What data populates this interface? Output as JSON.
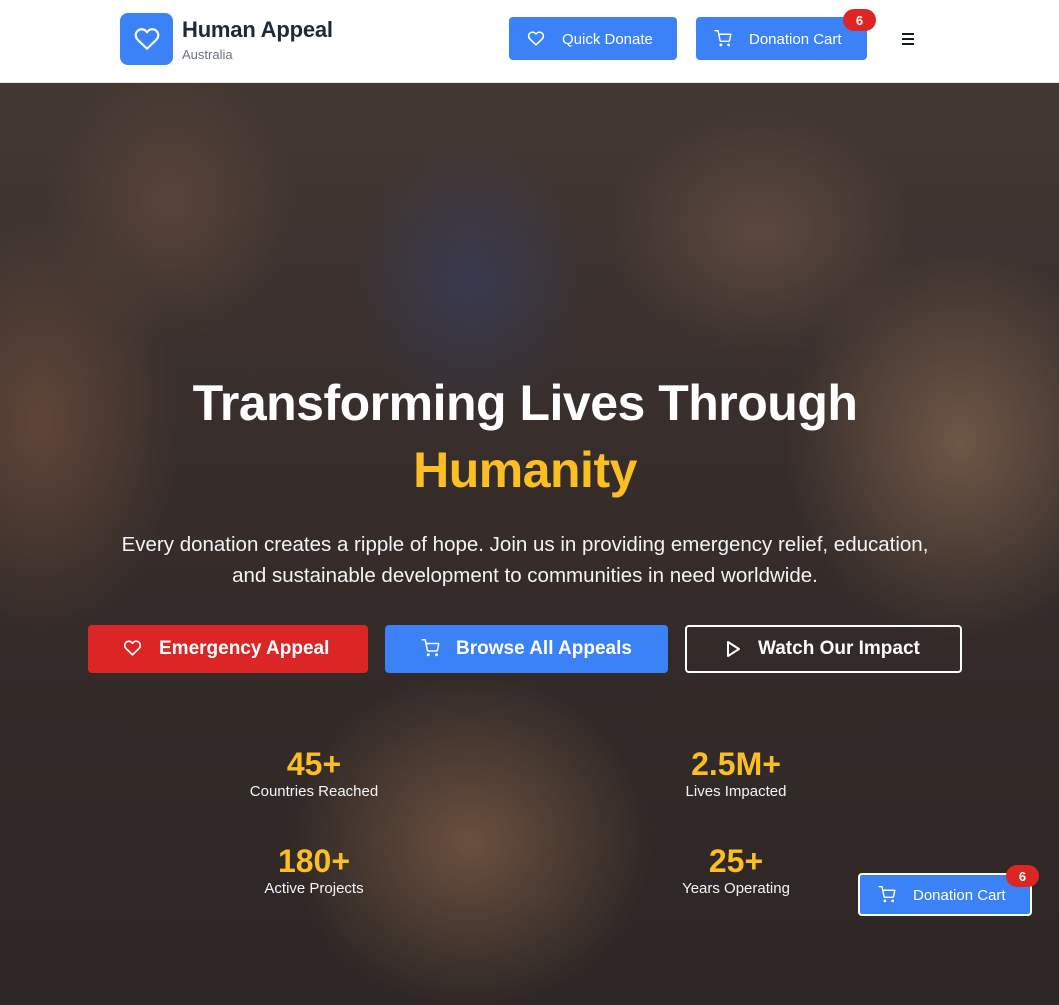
{
  "header": {
    "brand_name": "Human Appeal",
    "brand_sub": "Australia",
    "quick_donate_label": "Quick Donate",
    "cart_label": "Donation Cart",
    "cart_count": "6",
    "logo_icon": "heart-icon",
    "menu_icon": "hamburger-menu-icon"
  },
  "hero": {
    "title_line1": "Transforming Lives Through",
    "title_line2": "Humanity",
    "subtitle": "Every donation creates a ripple of hope. Join us in providing emergency relief, education, and sustainable development to communities in need worldwide.",
    "buttons": [
      {
        "label": "Emergency Appeal",
        "icon": "heart-icon"
      },
      {
        "label": "Browse All Appeals",
        "icon": "cart-icon"
      },
      {
        "label": "Watch Our Impact",
        "icon": "play-icon"
      }
    ],
    "stats": [
      {
        "value": "45+",
        "label": "Countries Reached"
      },
      {
        "value": "2.5M+",
        "label": "Lives Impacted"
      },
      {
        "value": "180+",
        "label": "Active Projects"
      },
      {
        "value": "25+",
        "label": "Years Operating"
      }
    ]
  },
  "floating_cart": {
    "label": "Donation Cart",
    "count": "6"
  },
  "colors": {
    "primary": "#3b82f6",
    "danger": "#dc2626",
    "accent": "#fbbf24",
    "text_dark": "#1f2937"
  }
}
